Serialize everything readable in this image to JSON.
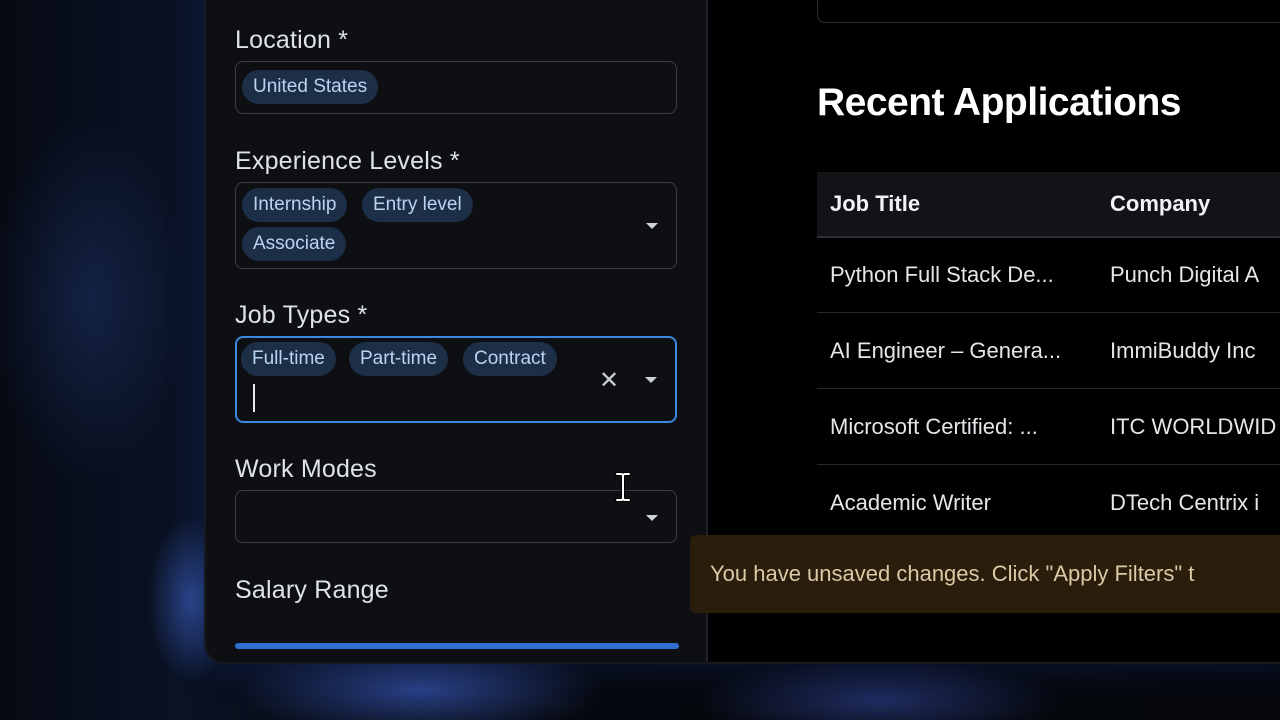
{
  "filters": {
    "location": {
      "label": "Location *",
      "chips": [
        "United States"
      ]
    },
    "experience": {
      "label": "Experience Levels *",
      "chips": [
        "Internship",
        "Entry level",
        "Associate"
      ]
    },
    "job_types": {
      "label": "Job Types *",
      "chips": [
        "Full-time",
        "Part-time",
        "Contract"
      ],
      "clear_icon": "close-icon"
    },
    "work_modes": {
      "label": "Work Modes",
      "value": ""
    },
    "salary": {
      "label": "Salary Range"
    },
    "accent_color": "#3a88e0",
    "chip_bg_color": "#1d2f46"
  },
  "recent": {
    "title": "Recent Applications",
    "columns": [
      "Job Title",
      "Company"
    ],
    "rows": [
      {
        "title": "Python Full Stack De...",
        "company": "Punch Digital A"
      },
      {
        "title": "AI Engineer – Genera...",
        "company": "ImmiBuddy Inc"
      },
      {
        "title": "Microsoft Certified: ...",
        "company": "ITC WORLDWID"
      },
      {
        "title": "Academic Writer",
        "company": "DTech Centrix i"
      }
    ]
  },
  "toast": {
    "text": "You have unsaved changes. Click \"Apply Filters\" t",
    "bg_color": "#2a1d0c"
  }
}
